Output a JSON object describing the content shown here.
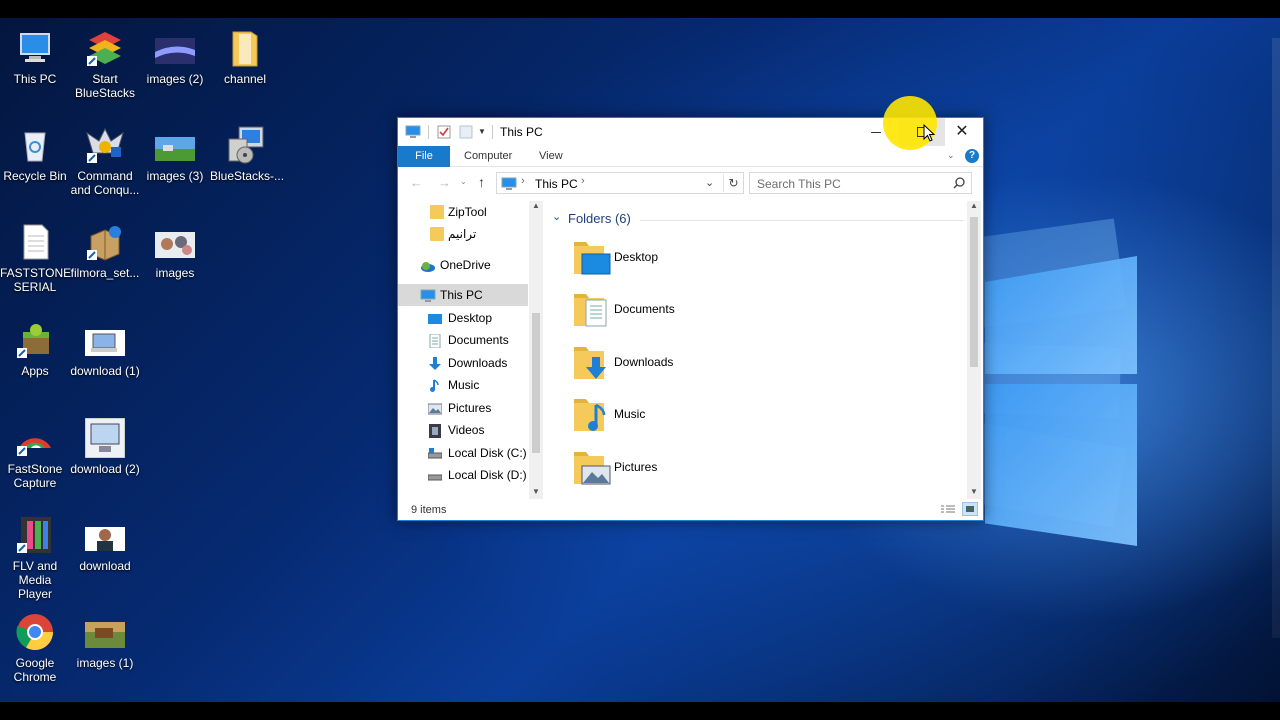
{
  "desktop": {
    "icons": [
      {
        "label": "This PC",
        "icon": "this-pc-icon"
      },
      {
        "label": "Recycle Bin",
        "icon": "recycle-bin-icon"
      },
      {
        "label": "FASTSTONE SERIAL",
        "icon": "text-document-icon"
      },
      {
        "label": "Apps",
        "icon": "android-apps-icon"
      },
      {
        "label": "FastStone Capture",
        "icon": "faststone-capture-icon"
      },
      {
        "label": "FLV and Media Player",
        "icon": "media-player-icon"
      },
      {
        "label": "Google Chrome",
        "icon": "chrome-icon"
      },
      {
        "label": "Start BlueStacks",
        "icon": "bluestacks-icon"
      },
      {
        "label": "Command and Conqu...",
        "icon": "command-and-conquer-icon"
      },
      {
        "label": "filmora_set...",
        "icon": "installer-box-icon"
      },
      {
        "label": "download (1)",
        "icon": "image-thumbnail-icon"
      },
      {
        "label": "download (2)",
        "icon": "image-thumbnail-icon"
      },
      {
        "label": "download",
        "icon": "image-thumbnail-icon"
      },
      {
        "label": "images (1)",
        "icon": "image-thumbnail-icon"
      },
      {
        "label": "images (2)",
        "icon": "image-thumbnail-icon"
      },
      {
        "label": "images (3)",
        "icon": "image-thumbnail-icon"
      },
      {
        "label": "images",
        "icon": "image-thumbnail-icon"
      },
      {
        "label": "channel",
        "icon": "folder-icon"
      },
      {
        "label": "BlueStacks-...",
        "icon": "installer-icon"
      }
    ]
  },
  "explorer": {
    "title": "This PC",
    "ribbon_tabs": [
      "File",
      "Computer",
      "View"
    ],
    "address": "This PC",
    "search_placeholder": "Search This PC",
    "nav": {
      "items": [
        "ZipTool",
        "ترانیم",
        "OneDrive",
        "This PC",
        "Desktop",
        "Documents",
        "Downloads",
        "Music",
        "Pictures",
        "Videos",
        "Local Disk (C:)",
        "Local Disk (D:)"
      ]
    },
    "folders_header": "Folders (6)",
    "folders": [
      "Desktop",
      "Documents",
      "Downloads",
      "Music",
      "Pictures"
    ],
    "status": "9 items"
  },
  "colors": {
    "accent": "#1979ca",
    "selection": "#d9d9d9",
    "folder_yellow": "#f5c95a",
    "cursor_highlight": "#ffe600"
  }
}
